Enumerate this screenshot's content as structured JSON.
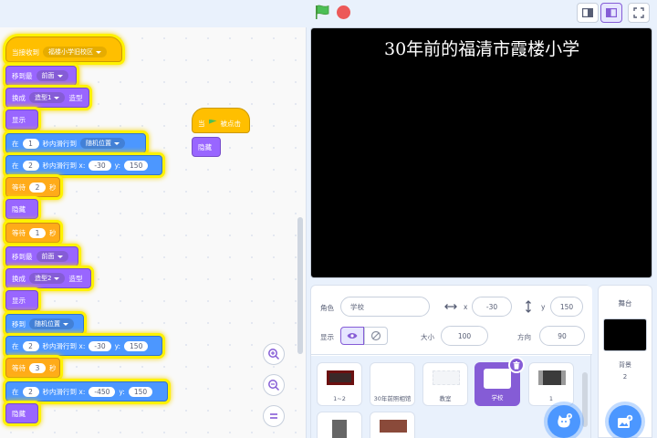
{
  "stage_text": {
    "title": "30年前的福清市霞楼小学"
  },
  "scripts": {
    "main": {
      "hat_label": "当接收到",
      "hat_value": "福楼小学旧校区",
      "goto_layer_label": "移到最",
      "goto_layer_value": "前面",
      "costume1_label": "换成",
      "costume1_value": "造型1",
      "costume1_suffix": "造型",
      "show1": "显示",
      "glide1_prefix": "在",
      "glide1_secs": "1",
      "glide1_mid": "秒内滑行到",
      "glide1_target": "随机位置",
      "glide2_prefix": "在",
      "glide2_secs": "2",
      "glide2_mid": "秒内滑行到 x:",
      "glide2_x": "-30",
      "glide2_y_label": "y:",
      "glide2_y": "150",
      "wait1_label": "等待",
      "wait1_value": "2",
      "wait1_unit": "秒",
      "hide1": "隐藏",
      "wait2_label": "等待",
      "wait2_value": "1",
      "wait2_unit": "秒",
      "goto_layer2_label": "移到最",
      "goto_layer2_value": "前面",
      "costume2_label": "换成",
      "costume2_value": "造型2",
      "costume2_suffix": "造型",
      "show2": "显示",
      "goto_label": "移到",
      "goto_value": "随机位置",
      "glide3_prefix": "在",
      "glide3_secs": "2",
      "glide3_mid": "秒内滑行到 x:",
      "glide3_x": "-30",
      "glide3_y_label": "y:",
      "glide3_y": "150",
      "wait3_label": "等待",
      "wait3_value": "3",
      "wait3_unit": "秒",
      "glide4_prefix": "在",
      "glide4_secs": "2",
      "glide4_mid": "秒内滑行到 x:",
      "glide4_x": "-450",
      "glide4_y_label": "y:",
      "glide4_y": "150",
      "hide2": "隐藏"
    },
    "flag_script": {
      "hat_prefix": "当",
      "hat_suffix": "被点击",
      "hide": "隐藏"
    }
  },
  "sprite_info": {
    "sprite_label": "角色",
    "sprite_name": "学校",
    "x_label": "x",
    "x_value": "-30",
    "y_label": "y",
    "y_value": "150",
    "show_label": "显示",
    "size_label": "大小",
    "size_value": "100",
    "direction_label": "方向",
    "direction_value": "90"
  },
  "sprites": [
    {
      "name": "1~2"
    },
    {
      "name": "30年前照相馆"
    },
    {
      "name": "教室"
    },
    {
      "name": "学校"
    },
    {
      "name": "1"
    }
  ],
  "stage_target": {
    "label": "舞台",
    "backdrop_label": "背景",
    "backdrop_count": "2"
  },
  "icons": {
    "run": "green-flag-icon",
    "stop": "stop-icon"
  },
  "colors": {
    "looks": "#9966ff",
    "motion": "#4c97ff",
    "control": "#ffab19",
    "events": "#ffbf00",
    "selected": "#855cd6",
    "highlight": "#fff200"
  }
}
